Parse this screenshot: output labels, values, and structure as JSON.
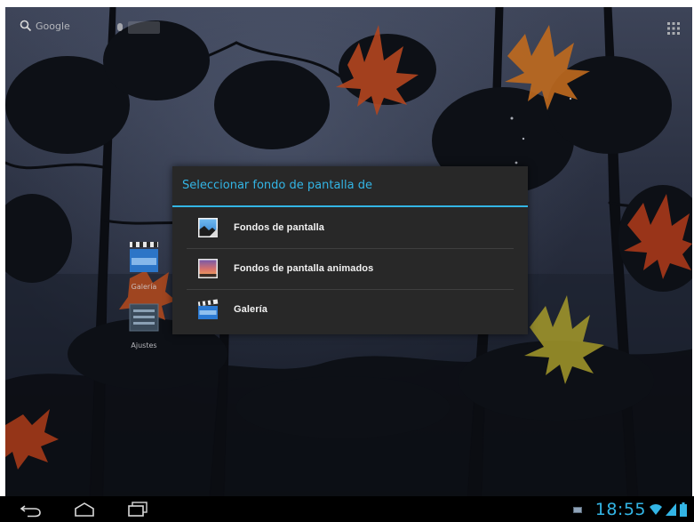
{
  "home": {
    "search_label": "Google",
    "shortcuts": [
      {
        "label": "Galería"
      },
      {
        "label": "Ajustes"
      }
    ]
  },
  "dialog": {
    "title": "Seleccionar fondo de pantalla de",
    "items": [
      {
        "label": "Fondos de pantalla",
        "icon": "wallpaper-picture-icon"
      },
      {
        "label": "Fondos de pantalla animados",
        "icon": "live-wallpaper-icon"
      },
      {
        "label": "Galería",
        "icon": "gallery-clapper-icon"
      }
    ]
  },
  "status_bar": {
    "time": "18:55"
  },
  "colors": {
    "accent": "#33b5e5",
    "dialog_bg": "#282828",
    "navbar_bg": "#000000"
  }
}
